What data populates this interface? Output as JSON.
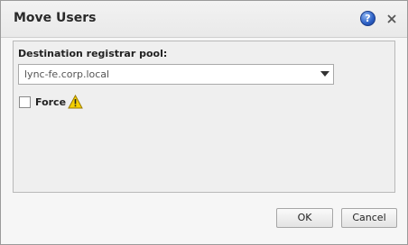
{
  "dialog": {
    "title": "Move Users",
    "help_icon_glyph": "?",
    "help_icon": "help-icon",
    "close_icon": "close-icon"
  },
  "form": {
    "pool_label": "Destination registrar pool:",
    "pool_value": "lync-fe.corp.local",
    "force_label": "Force",
    "force_checked": false,
    "warning_icon": "warning-icon"
  },
  "buttons": {
    "ok_label": "OK",
    "cancel_label": "Cancel"
  },
  "colors": {
    "help_blue": "#2b5fc4",
    "warning_yellow": "#f5d000"
  }
}
